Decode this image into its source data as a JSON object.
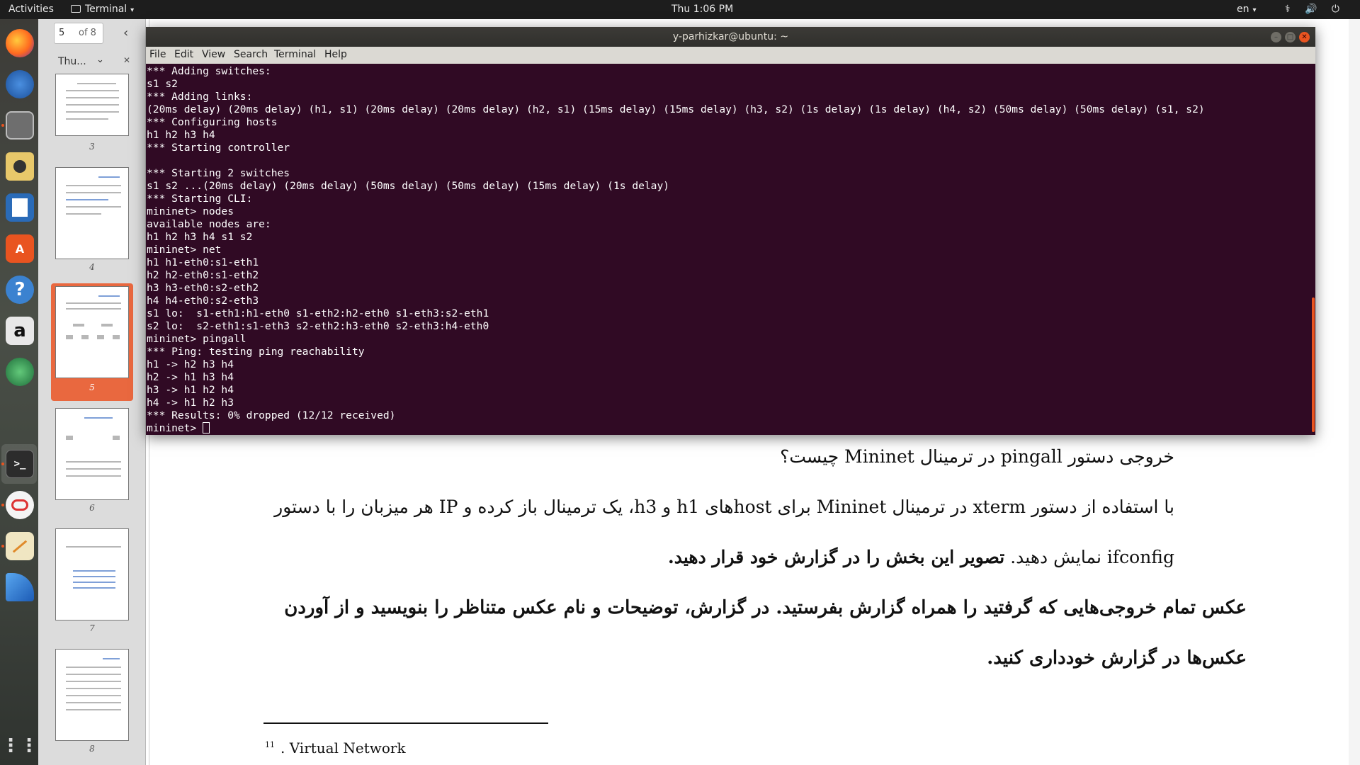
{
  "topbar": {
    "activities": "Activities",
    "app_name": "Terminal",
    "clock": "Thu  1:06 PM",
    "lang": "en",
    "sys_icons": "⚕ 🔊 ⏻"
  },
  "viewer": {
    "page_input": "5",
    "page_of": "of 8",
    "side_tab": "Thu...",
    "thumbnails": [
      {
        "num": "3"
      },
      {
        "num": "4"
      },
      {
        "num": "5"
      },
      {
        "num": "6"
      },
      {
        "num": "7"
      },
      {
        "num": "8"
      }
    ]
  },
  "terminal": {
    "title": "y-parhizkar@ubuntu: ~",
    "menu": [
      "File",
      "Edit",
      "View",
      "Search",
      "Terminal",
      "Help"
    ],
    "lines": [
      "*** Adding switches:",
      "s1 s2",
      "*** Adding links:",
      "(20ms delay) (20ms delay) (h1, s1) (20ms delay) (20ms delay) (h2, s1) (15ms delay) (15ms delay) (h3, s2) (1s delay) (1s delay) (h4, s2) (50ms delay) (50ms delay) (s1, s2)",
      "*** Configuring hosts",
      "h1 h2 h3 h4",
      "*** Starting controller",
      "",
      "*** Starting 2 switches",
      "s1 s2 ...(20ms delay) (20ms delay) (50ms delay) (50ms delay) (15ms delay) (1s delay)",
      "*** Starting CLI:",
      "mininet> nodes",
      "available nodes are:",
      "h1 h2 h3 h4 s1 s2",
      "mininet> net",
      "h1 h1-eth0:s1-eth1",
      "h2 h2-eth0:s1-eth2",
      "h3 h3-eth0:s2-eth2",
      "h4 h4-eth0:s2-eth3",
      "s1 lo:  s1-eth1:h1-eth0 s1-eth2:h2-eth0 s1-eth3:s2-eth1",
      "s2 lo:  s2-eth1:s1-eth3 s2-eth2:h3-eth0 s2-eth3:h4-eth0",
      "mininet> pingall",
      "*** Ping: testing ping reachability",
      "h1 -> h2 h3 h4",
      "h2 -> h1 h3 h4",
      "h3 -> h1 h2 h4",
      "h4 -> h1 h2 h3",
      "*** Results: 0% dropped (12/12 received)"
    ],
    "prompt": "mininet> "
  },
  "document": {
    "q1": "خروجی دستور pingall در ترمینال Mininet چیست؟",
    "q2_line1": "با استفاده از دستور xterm در ترمینال Mininet برای hostهای h1 و h3، یک ترمینال باز کرده و IP هر میزبان را با دستور",
    "q2_line2_plain": "ifconfig نمایش دهید. ",
    "q2_line2_bold": "تصویر این بخش را در گزارش خود قرار دهید.",
    "p1": "عکس تمام خروجی‌هایی که گرفتید را همراه گزارش بفرستید. در گزارش، توضیحات و نام عکس متناظر را بنویسید و از آوردن",
    "p2": "عکس‌ها در گزارش خودداری کنید.",
    "footnote_num": "11",
    "footnote_text": ". Virtual Network"
  }
}
